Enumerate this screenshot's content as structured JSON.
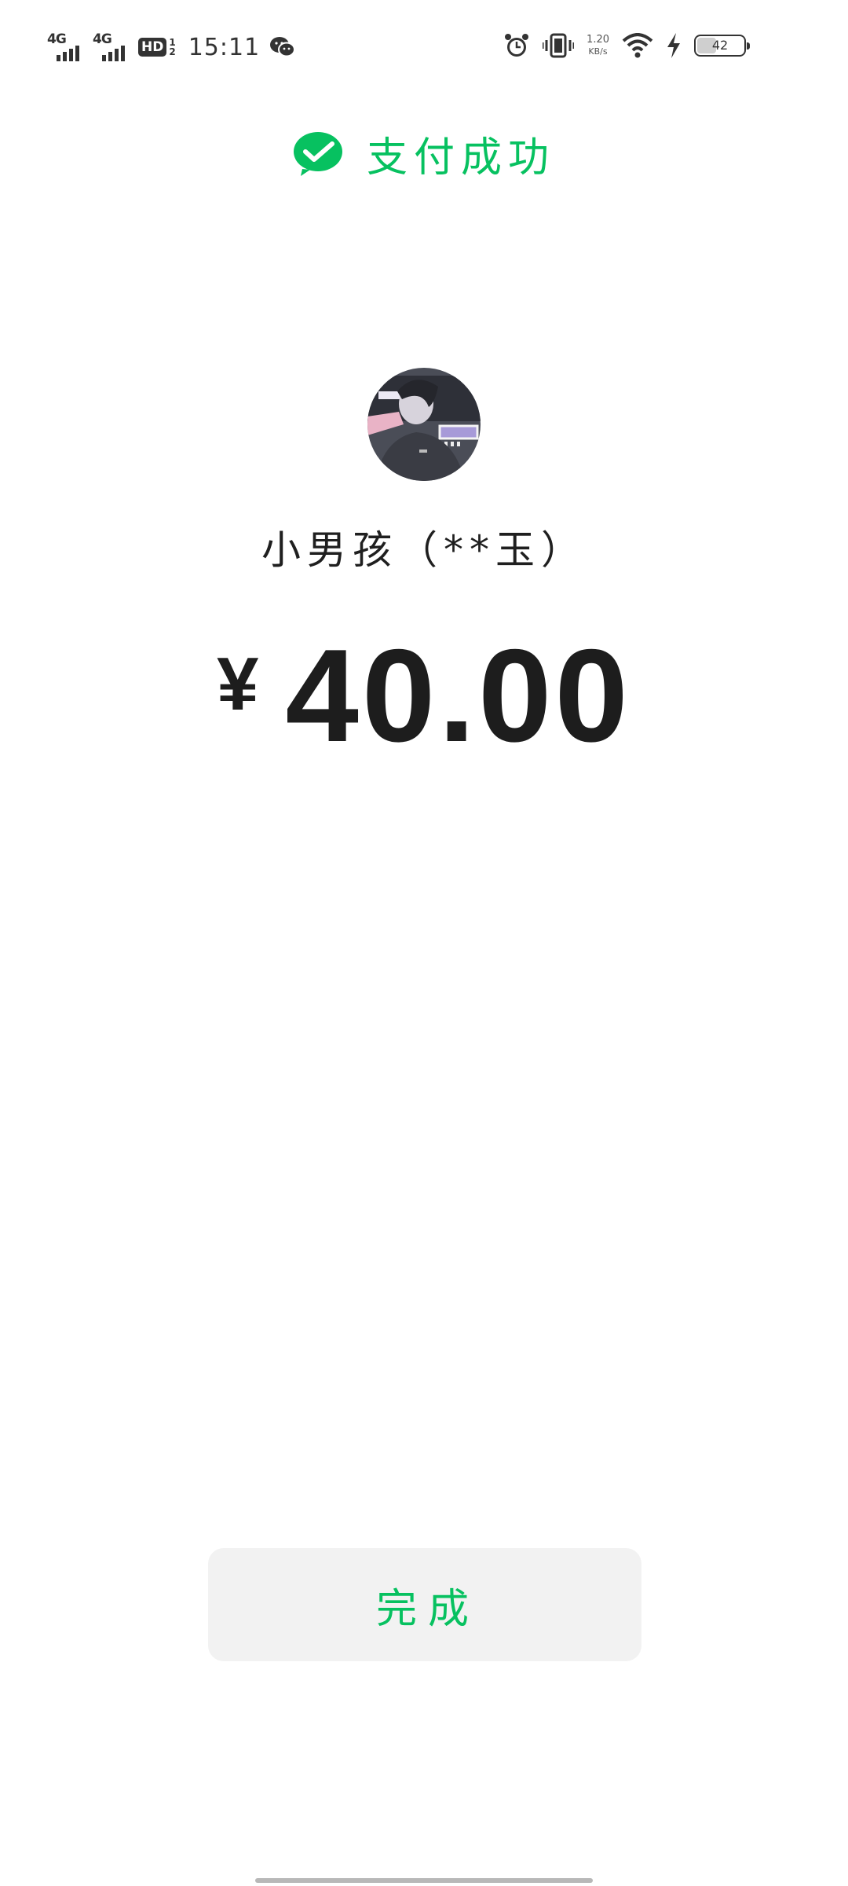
{
  "status_bar": {
    "network_1": "4G",
    "network_2": "4G",
    "hd": "HD",
    "hd_sub_top": "1",
    "hd_sub_bottom": "2",
    "time": "15:11",
    "speed_value": "1.20",
    "speed_unit": "KB/s",
    "battery_level": "42",
    "battery_fraction": 0.42,
    "icons": [
      "wechat-notification-icon",
      "alarm-icon",
      "vibrate-icon",
      "wifi-icon",
      "charging-icon",
      "battery-icon"
    ]
  },
  "header": {
    "title": "支付成功",
    "icon": "wechat-pay-check-icon"
  },
  "payee": {
    "name": "小男孩（**玉）",
    "avatar": "avatar"
  },
  "payment": {
    "currency": "¥",
    "amount": "40.00"
  },
  "actions": {
    "done_label": "完成"
  },
  "colors": {
    "accent": "#07c160",
    "text": "#1f1f1f",
    "button_bg": "#f2f2f2"
  }
}
